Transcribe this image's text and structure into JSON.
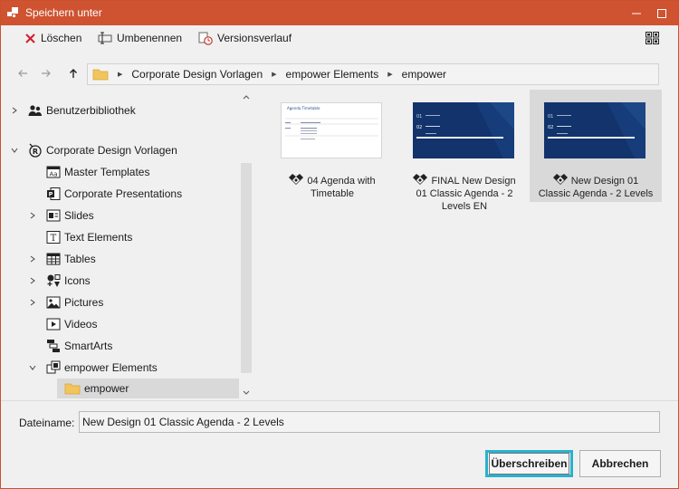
{
  "window": {
    "title": "Speichern unter"
  },
  "toolbar": {
    "delete_label": "Löschen",
    "rename_label": "Umbenennen",
    "history_label": "Versionsverlauf"
  },
  "breadcrumb": [
    "Corporate Design Vorlagen",
    "empower Elements",
    "empower"
  ],
  "tree": {
    "items": [
      {
        "label": "Benutzerbibliothek",
        "icon": "users-icon",
        "expandable": true,
        "expanded": false
      },
      {
        "label": "Corporate Design Vorlagen",
        "icon": "brand-icon",
        "expandable": true,
        "expanded": true
      },
      {
        "label": "Master Templates",
        "icon": "master-icon",
        "expandable": false
      },
      {
        "label": "Corporate Presentations",
        "icon": "powerpoint-icon",
        "expandable": false
      },
      {
        "label": "Slides",
        "icon": "slides-icon",
        "expandable": true,
        "expanded": false
      },
      {
        "label": "Text Elements",
        "icon": "text-icon",
        "expandable": false
      },
      {
        "label": "Tables",
        "icon": "table-icon",
        "expandable": true,
        "expanded": false
      },
      {
        "label": "Icons",
        "icon": "icons-icon",
        "expandable": true,
        "expanded": false
      },
      {
        "label": "Pictures",
        "icon": "picture-icon",
        "expandable": true,
        "expanded": false
      },
      {
        "label": "Videos",
        "icon": "video-icon",
        "expandable": false
      },
      {
        "label": "SmartArts",
        "icon": "smartart-icon",
        "expandable": false
      },
      {
        "label": "empower Elements",
        "icon": "elements-icon",
        "expandable": true,
        "expanded": true
      },
      {
        "label": "empower",
        "icon": "folder-icon",
        "expandable": false,
        "selected": true
      }
    ]
  },
  "files": [
    {
      "name": "04 Agenda with Timetable",
      "line1": "04 Agenda with",
      "line2": "Timetable",
      "line3": "",
      "thumb": "white",
      "thumb_title": "Agenda Timetable"
    },
    {
      "name": "FINAL New Design 01 Classic Agenda - 2 Levels EN",
      "line1": "FINAL New Design",
      "line2": "01 Classic Agenda - 2",
      "line3": "Levels EN",
      "thumb": "blue"
    },
    {
      "name": "New Design 01 Classic Agenda - 2 Levels",
      "line1": "New Design 01",
      "line2": "Classic Agenda - 2 Levels",
      "line3": "",
      "thumb": "blue",
      "selected": true
    }
  ],
  "filename": {
    "label": "Dateiname:",
    "value": "New Design 01 Classic Agenda - 2 Levels"
  },
  "buttons": {
    "overwrite": "Überschreiben",
    "cancel": "Abbrechen"
  },
  "colors": {
    "titlebar": "#cf5331",
    "selection": "#d9d9d9",
    "focus": "#27b2cf",
    "thumb_blue": "#12336b"
  }
}
